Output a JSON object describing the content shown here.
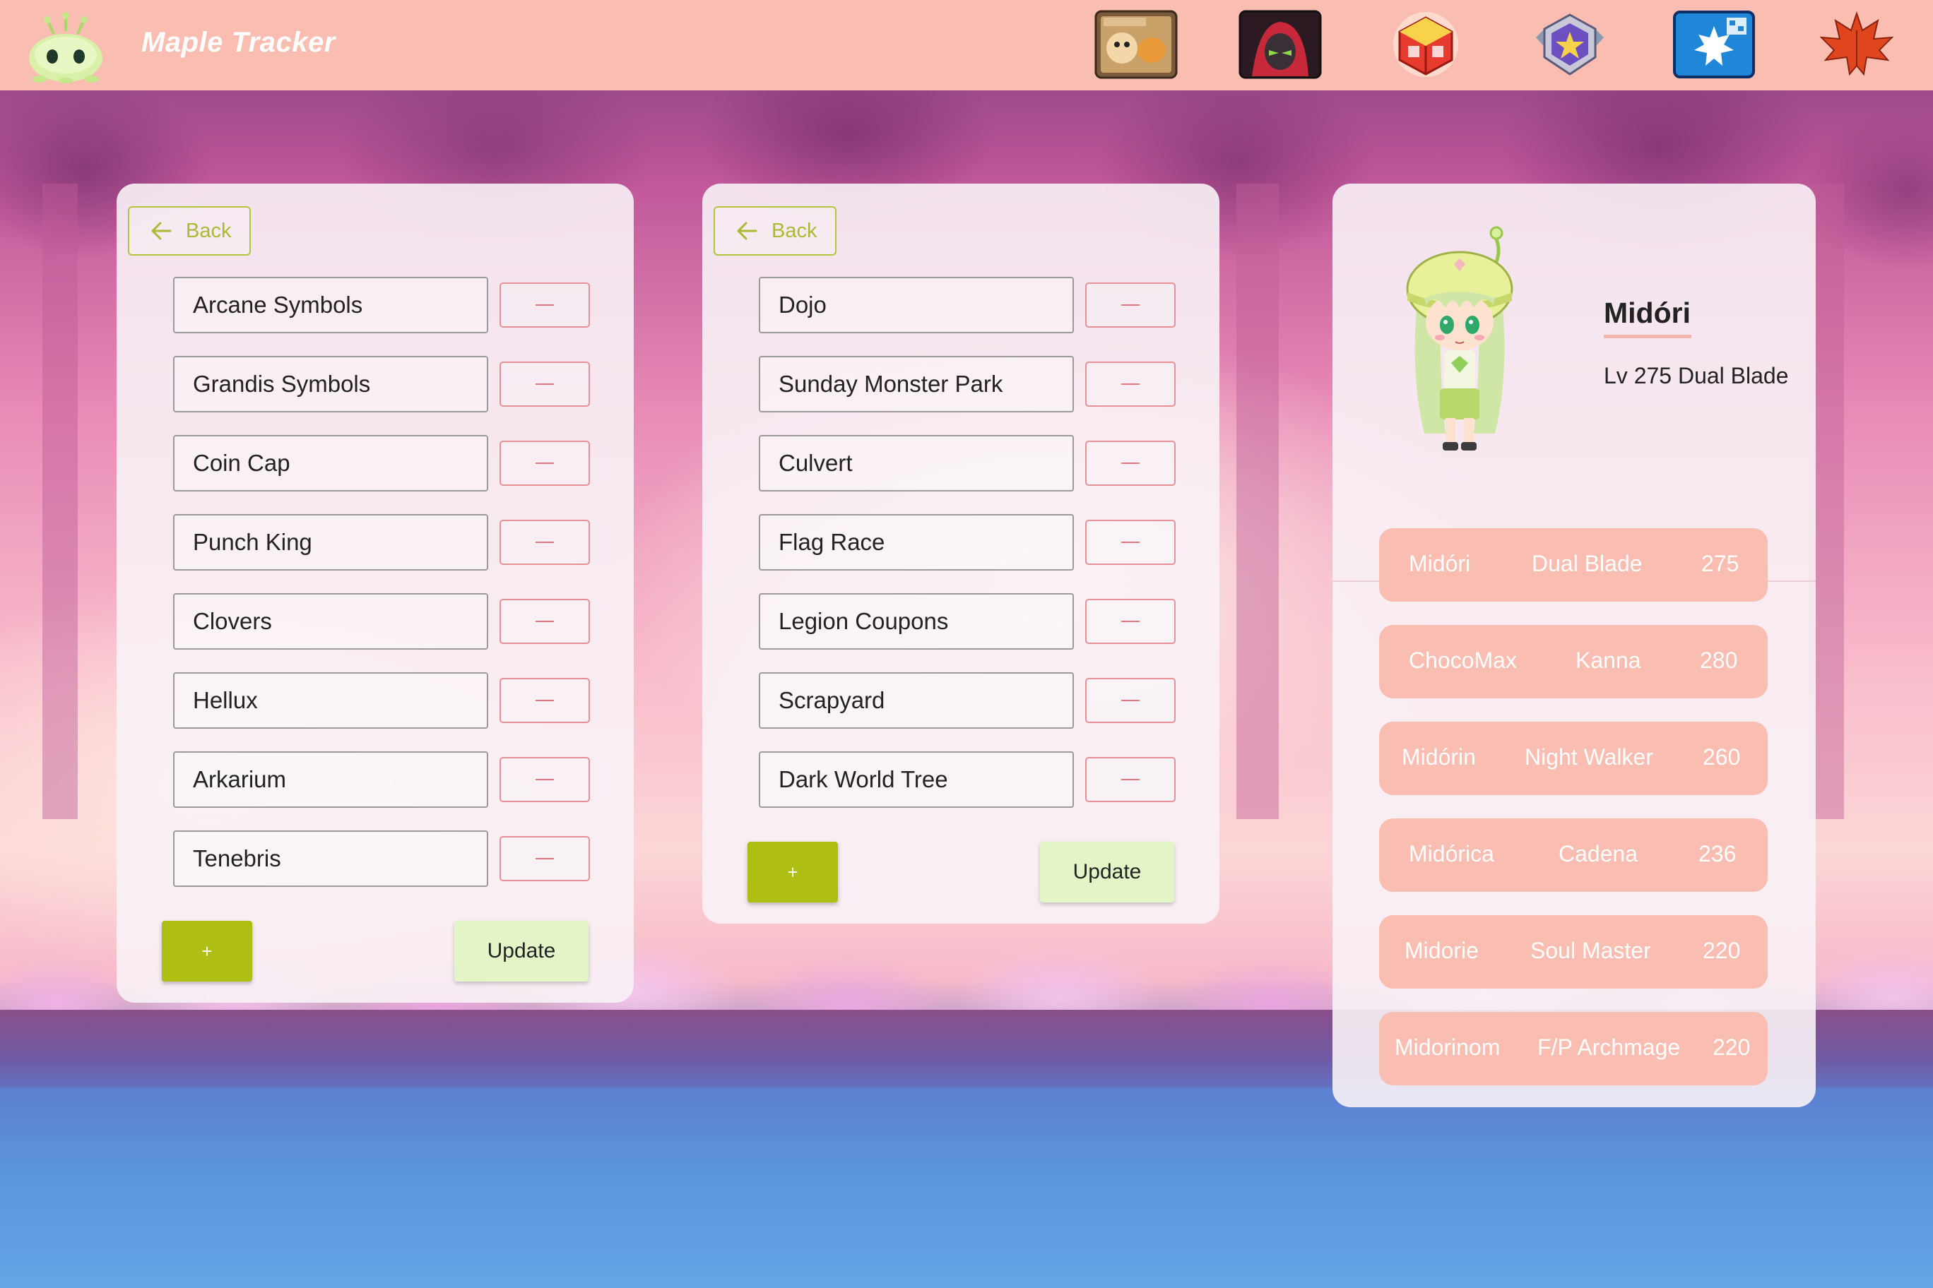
{
  "app": {
    "title": "Maple Tracker"
  },
  "header": {
    "icons": [
      "hungry-muto-icon",
      "character-portrait-icon",
      "red-cube-icon",
      "badge-star-icon",
      "maple-link-icon",
      "maple-leaf-icon"
    ]
  },
  "left_panel": {
    "back_label": "Back",
    "items": [
      {
        "label": "Arcane Symbols",
        "remove": "—"
      },
      {
        "label": "Grandis Symbols",
        "remove": "—"
      },
      {
        "label": "Coin Cap",
        "remove": "—"
      },
      {
        "label": "Punch King",
        "remove": "—"
      },
      {
        "label": "Clovers",
        "remove": "—"
      },
      {
        "label": "Hellux",
        "remove": "—"
      },
      {
        "label": "Arkarium",
        "remove": "—"
      },
      {
        "label": "Tenebris",
        "remove": "—"
      }
    ],
    "add_label": "+",
    "update_label": "Update"
  },
  "middle_panel": {
    "back_label": "Back",
    "items": [
      {
        "label": "Dojo",
        "remove": "—"
      },
      {
        "label": "Sunday Monster Park",
        "remove": "—"
      },
      {
        "label": "Culvert",
        "remove": "—"
      },
      {
        "label": "Flag Race",
        "remove": "—"
      },
      {
        "label": "Legion Coupons",
        "remove": "—"
      },
      {
        "label": "Scrapyard",
        "remove": "—"
      },
      {
        "label": "Dark World Tree",
        "remove": "—"
      }
    ],
    "add_label": "+",
    "update_label": "Update"
  },
  "profile": {
    "name": "Midóri",
    "subtitle": "Lv 275 Dual Blade",
    "characters": [
      {
        "name": "Midóri",
        "job": "Dual Blade",
        "level": "275"
      },
      {
        "name": "ChocoMax",
        "job": "Kanna",
        "level": "280"
      },
      {
        "name": "Midórin",
        "job": "Night Walker",
        "level": "260"
      },
      {
        "name": "Midórica",
        "job": "Cadena",
        "level": "236"
      },
      {
        "name": "Midorie",
        "job": "Soul Master",
        "level": "220"
      },
      {
        "name": "Midorinom",
        "job": "F/P Archmage",
        "level": "220"
      }
    ]
  },
  "colors": {
    "header": "#f9bdb1",
    "accent_green": "#aebe12",
    "update_green": "#e3f5c6",
    "remove_red": "#e58f98",
    "character_row": "#f9bdb1"
  }
}
